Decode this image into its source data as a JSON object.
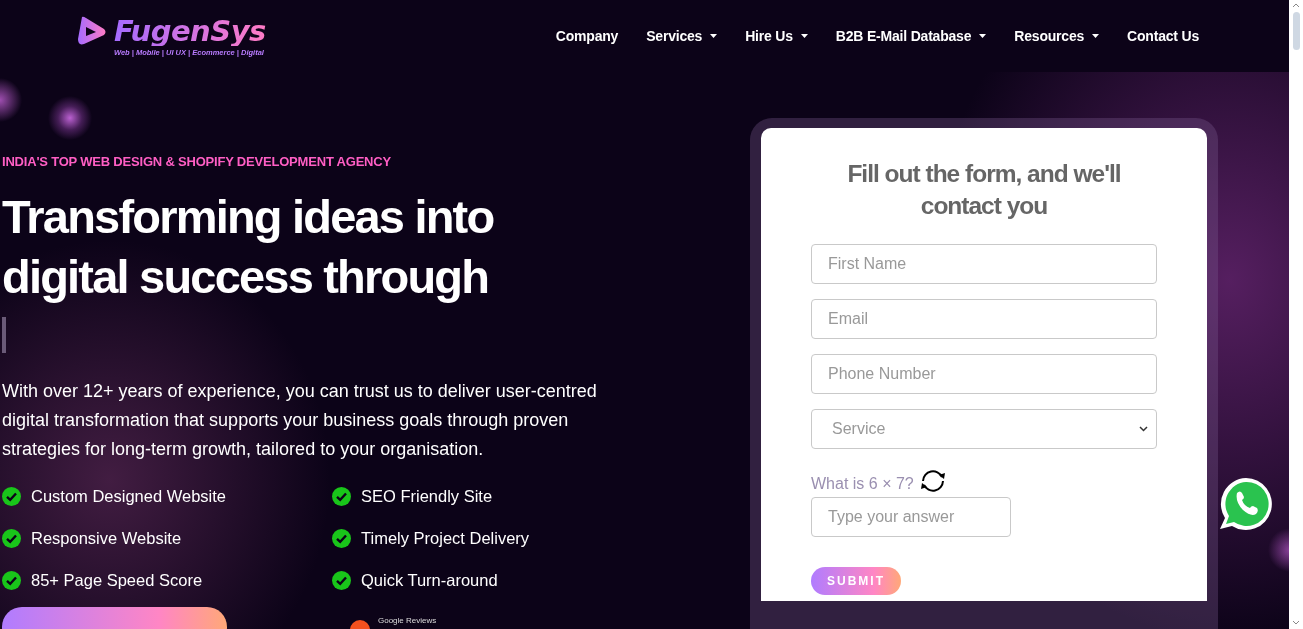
{
  "header": {
    "logo": "FugenSys",
    "tagline": "Web | Mobile | UI UX | Ecommerce | Digital",
    "nav": [
      {
        "label": "Company",
        "has_dropdown": false
      },
      {
        "label": "Services",
        "has_dropdown": true
      },
      {
        "label": "Hire Us",
        "has_dropdown": true
      },
      {
        "label": "B2B E-Mail Database",
        "has_dropdown": true
      },
      {
        "label": "Resources",
        "has_dropdown": true
      },
      {
        "label": "Contact Us",
        "has_dropdown": false
      }
    ]
  },
  "hero": {
    "kicker": "INDIA'S TOP WEB DESIGN & SHOPIFY DEVELOPMENT AGENCY",
    "heading_lines": [
      "Transforming ideas into",
      "digital success through"
    ],
    "description": "With over 12+ years of experience, you can trust us to deliver user-centred digital transformation that supports your business goals through proven strategies for long-term growth, tailored to your organisation.",
    "features": [
      "Custom Designed Website",
      "SEO Friendly Site",
      "Responsive Website",
      "Timely Project Delivery",
      "85+ Page Speed Score",
      "Quick Turn-around"
    ],
    "reviews_label": "Google Reviews"
  },
  "form": {
    "title": "Fill out the form, and we'll contact you",
    "fields": [
      {
        "kind": "text",
        "placeholder": "First Name"
      },
      {
        "kind": "text",
        "placeholder": "Email"
      },
      {
        "kind": "text",
        "placeholder": "Phone Number"
      },
      {
        "kind": "select",
        "placeholder": "Service"
      }
    ],
    "captcha_question": "What is 6 × 7?",
    "answer_placeholder": "Type your answer",
    "submit": "SUBMIT"
  }
}
